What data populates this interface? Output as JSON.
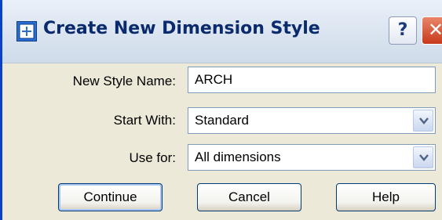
{
  "window": {
    "title": "Create New Dimension Style",
    "help_glyph": "?",
    "close_glyph": "✕",
    "title_icon": "dimension-style-icon"
  },
  "form": {
    "style_name": {
      "label": "New Style Name:",
      "value": "ARCH"
    },
    "start_with": {
      "label": "Start With:",
      "value": "Standard"
    },
    "use_for": {
      "label": "Use for:",
      "value": "All dimensions"
    }
  },
  "buttons": {
    "continue": "Continue",
    "cancel": "Cancel",
    "help": "Help"
  },
  "colors": {
    "accent_border": "#0842c8",
    "title_text": "#0a2a6e",
    "close_button": "#c8391b",
    "dialog_background": "#ece9d8"
  }
}
